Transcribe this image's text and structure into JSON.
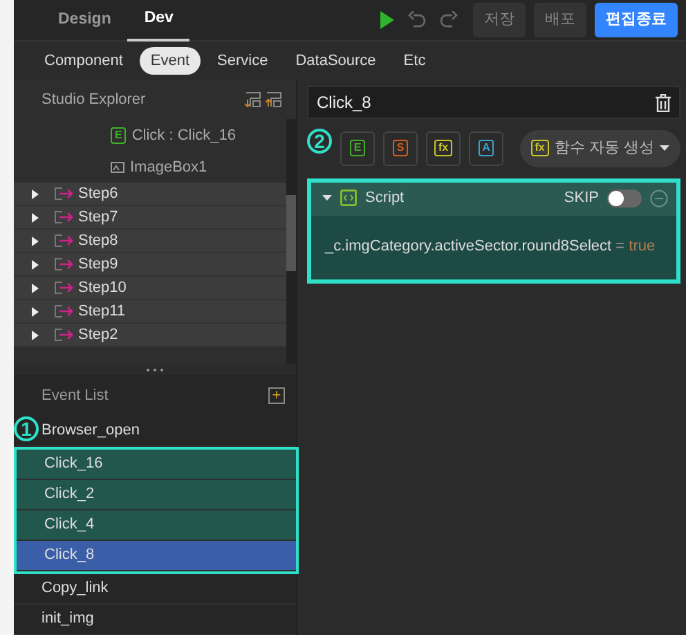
{
  "top_tabs": [
    {
      "label": "Design",
      "selected": false
    },
    {
      "label": "Dev",
      "selected": true
    }
  ],
  "toolbar": {
    "buttons": [
      {
        "label": "저장",
        "kind": "plain"
      },
      {
        "label": "배포",
        "kind": "plain"
      },
      {
        "label": "편집종료",
        "kind": "primary"
      }
    ]
  },
  "sub_tabs": [
    {
      "label": "Component",
      "selected": false
    },
    {
      "label": "Event",
      "selected": true
    },
    {
      "label": "Service",
      "selected": false
    },
    {
      "label": "DataSource",
      "selected": false
    },
    {
      "label": "Etc",
      "selected": false
    }
  ],
  "explorer": {
    "title": "Studio Explorer",
    "items": [
      {
        "kind": "event",
        "badge": "E",
        "label": "Click : Click_16"
      },
      {
        "kind": "image",
        "label": "ImageBox1"
      },
      {
        "kind": "step",
        "label": "Step6",
        "expanded": false
      },
      {
        "kind": "step",
        "label": "Step7",
        "expanded": false
      },
      {
        "kind": "step",
        "label": "Step8",
        "expanded": false
      },
      {
        "kind": "step",
        "label": "Step9",
        "expanded": false
      },
      {
        "kind": "step",
        "label": "Step10",
        "expanded": false
      },
      {
        "kind": "step",
        "label": "Step11",
        "expanded": false
      },
      {
        "kind": "step",
        "label": "Step2",
        "expanded": false
      }
    ]
  },
  "event_list": {
    "title": "Event List",
    "add_label": "+",
    "callout": "1",
    "items": [
      {
        "label": "Browser_open",
        "marked": false,
        "selected": false
      },
      {
        "label": "Click_16",
        "marked": true,
        "selected": false
      },
      {
        "label": "Click_2",
        "marked": true,
        "selected": false
      },
      {
        "label": "Click_4",
        "marked": true,
        "selected": false
      },
      {
        "label": "Click_8",
        "marked": true,
        "selected": true
      },
      {
        "label": "Copy_link",
        "marked": false,
        "selected": false
      },
      {
        "label": "init_img",
        "marked": false,
        "selected": false
      }
    ]
  },
  "detail": {
    "title": "Click_8",
    "callout": "2",
    "type_buttons": [
      {
        "badge": "E",
        "color": "#3fae2a"
      },
      {
        "badge": "S",
        "color": "#d2601a"
      },
      {
        "badge": "fx",
        "color": "#c9c22a"
      },
      {
        "badge": "A",
        "color": "#3aa0d0"
      }
    ],
    "generate": {
      "badge": "fx",
      "label": "함수 자동 생성"
    },
    "script": {
      "title": "Script",
      "expanded": true,
      "skip_label": "SKIP",
      "skip_on": false,
      "code": "_c.imgCategory.activeSector.round8Select",
      "operator": "=",
      "value": "true"
    }
  }
}
